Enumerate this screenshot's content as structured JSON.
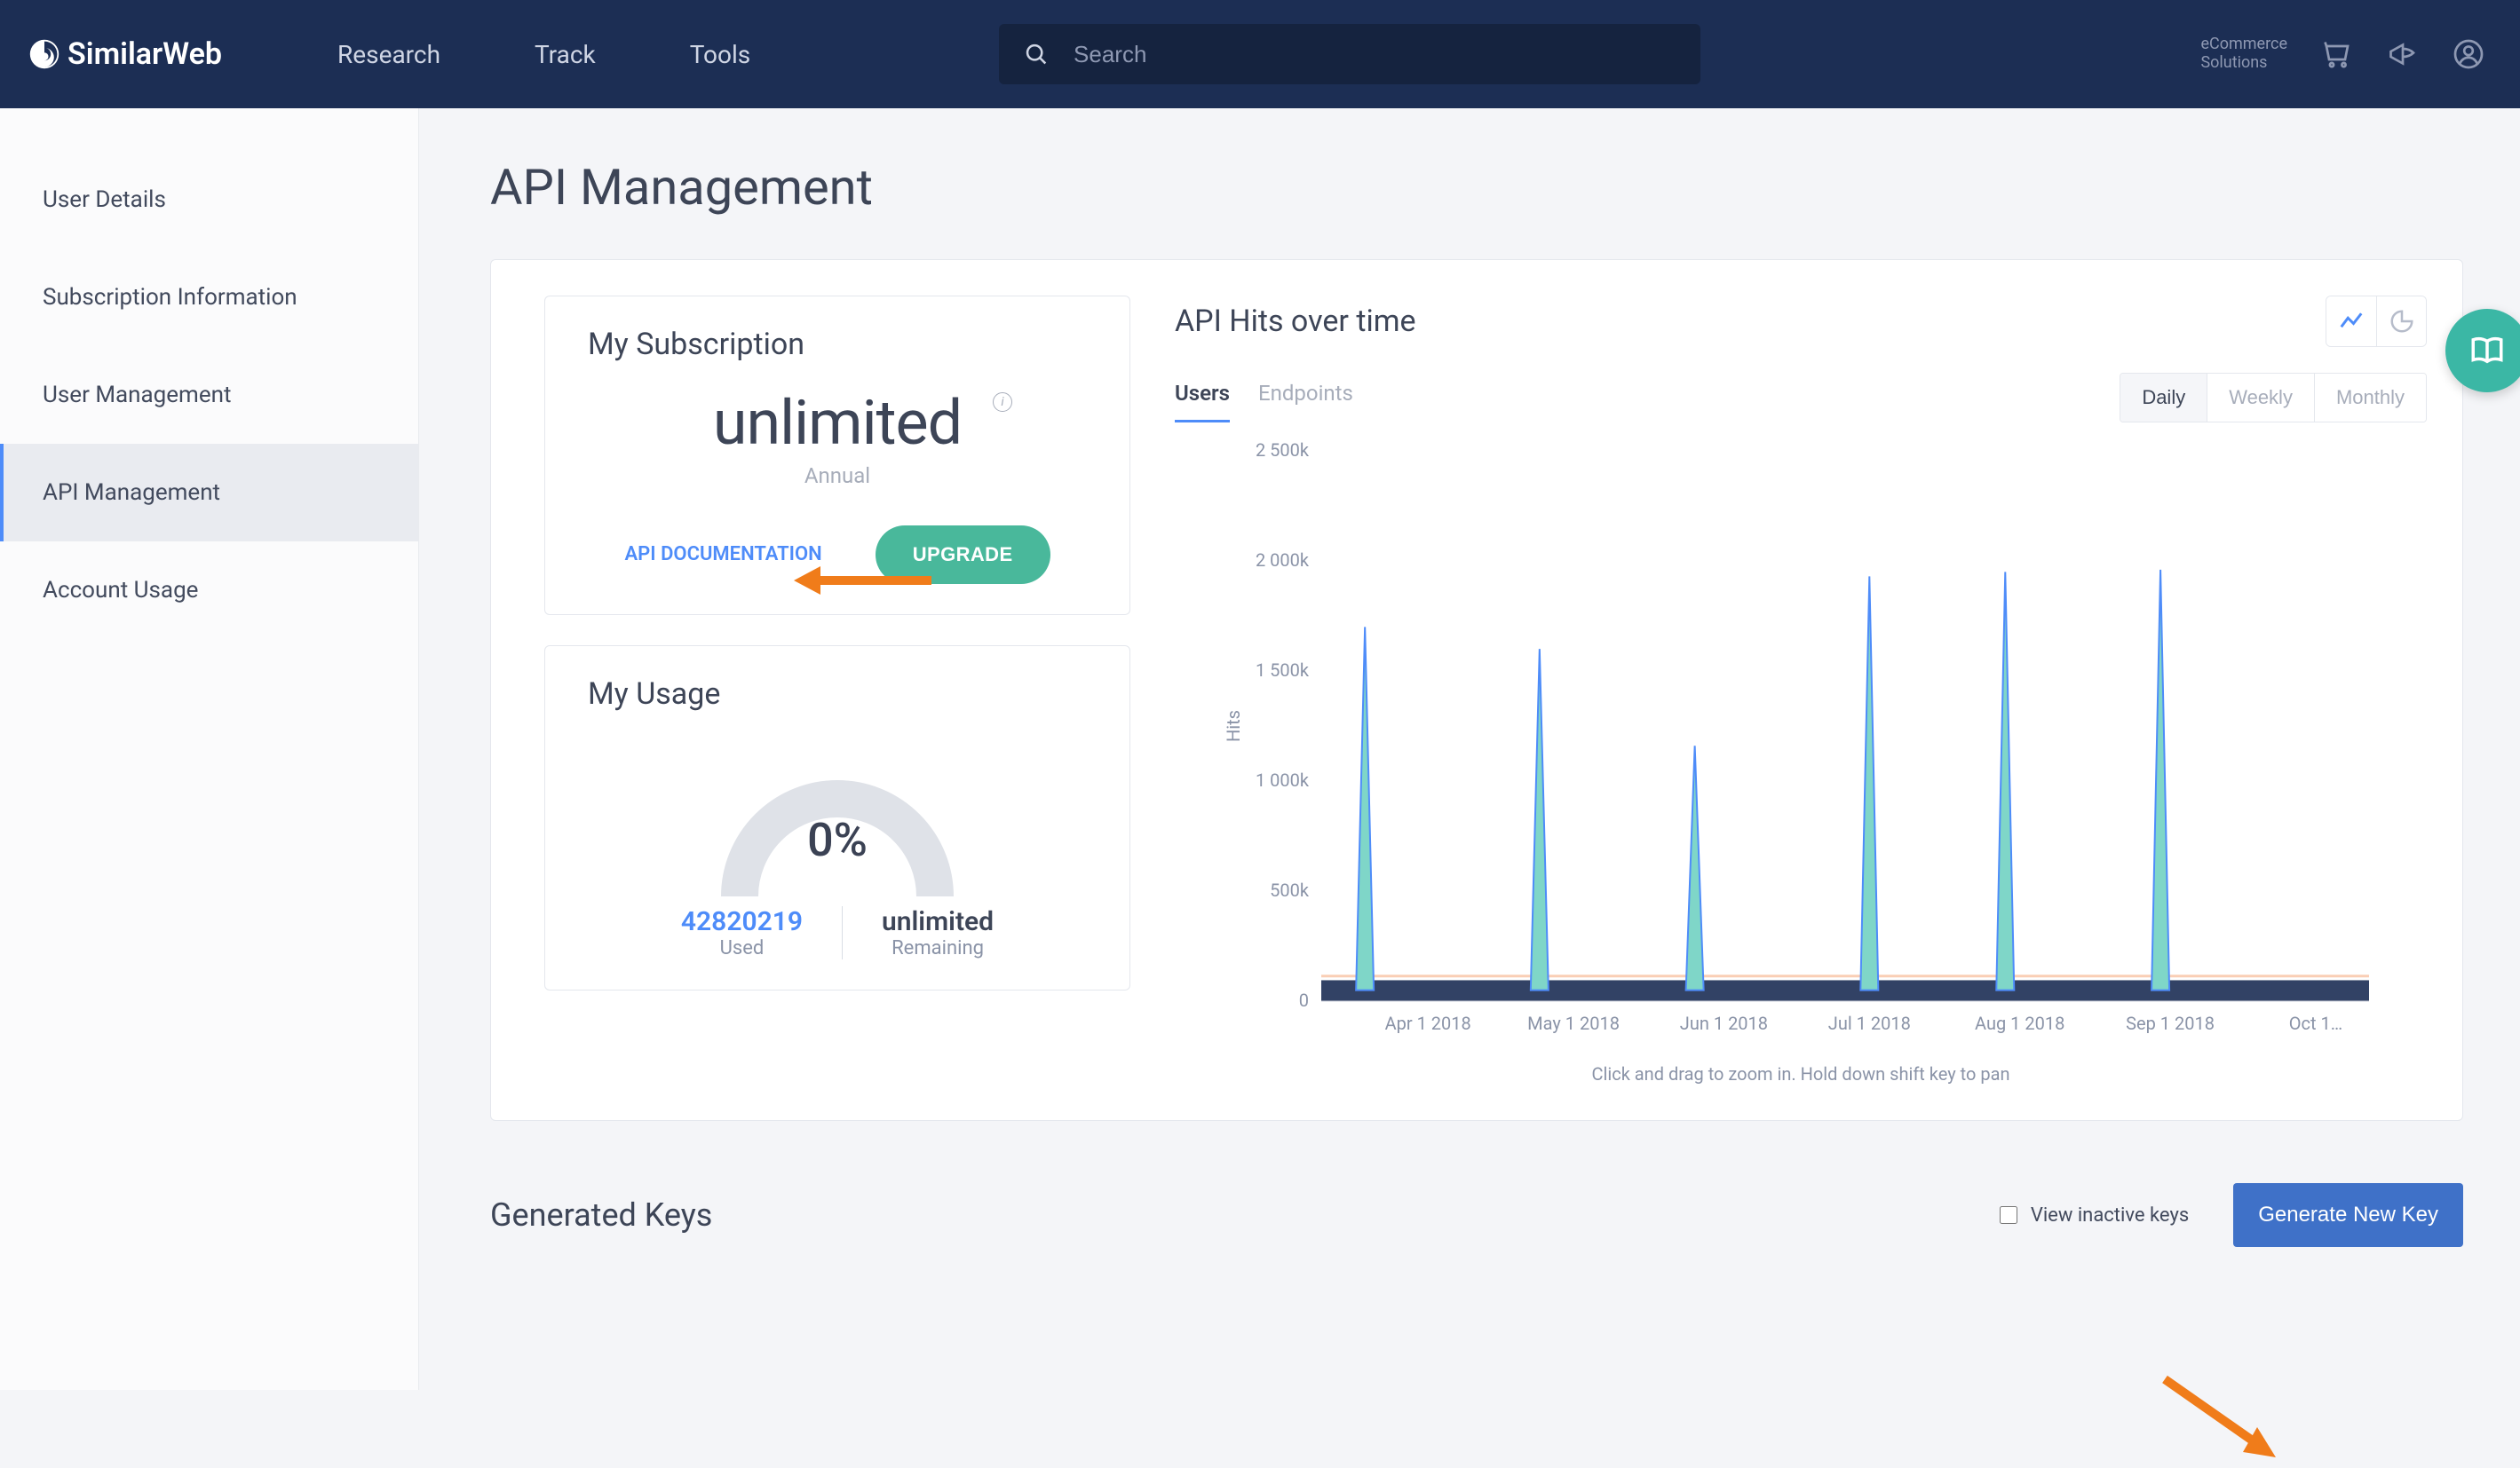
{
  "brand": "SimilarWeb",
  "topnav": {
    "research": "Research",
    "track": "Track",
    "tools": "Tools"
  },
  "search": {
    "placeholder": "Search"
  },
  "header_right": {
    "ecom_line1": "eCommerce",
    "ecom_line2": "Solutions"
  },
  "sidebar": {
    "items": [
      {
        "id": "user-details",
        "label": "User Details"
      },
      {
        "id": "subscription-info",
        "label": "Subscription Information"
      },
      {
        "id": "user-management",
        "label": "User Management"
      },
      {
        "id": "api-management",
        "label": "API Management",
        "selected": true
      },
      {
        "id": "account-usage",
        "label": "Account Usage"
      }
    ]
  },
  "page": {
    "title": "API Management"
  },
  "subscription": {
    "title": "My Subscription",
    "value": "unlimited",
    "period": "Annual",
    "doc_link": "API DOCUMENTATION",
    "upgrade": "UPGRADE"
  },
  "usage": {
    "title": "My Usage",
    "percent": "0%",
    "used_value": "42820219",
    "used_label": "Used",
    "remaining_value": "unlimited",
    "remaining_label": "Remaining"
  },
  "hits": {
    "title": "API Hits over time",
    "tabs": {
      "users": "Users",
      "endpoints": "Endpoints"
    },
    "ranges": {
      "daily": "Daily",
      "weekly": "Weekly",
      "monthly": "Monthly"
    },
    "y_label": "Hits",
    "hint": "Click and drag to zoom in. Hold down shift key to pan"
  },
  "generated_keys": {
    "title": "Generated Keys",
    "view_inactive": "View inactive keys",
    "generate": "Generate New Key"
  },
  "chart_data": {
    "type": "line",
    "title": "API Hits over time",
    "xlabel": "",
    "ylabel": "Hits",
    "ylim": [
      0,
      2500000
    ],
    "y_ticks": [
      0,
      500000,
      1000000,
      1500000,
      2000000,
      2500000
    ],
    "y_tick_labels": [
      "0",
      "500k",
      "1 000k",
      "1 500k",
      "2 000k",
      "2 500k"
    ],
    "x_tick_labels": [
      "Apr 1 2018",
      "May 1 2018",
      "Jun 1 2018",
      "Jul 1 2018",
      "Aug 1 2018",
      "Sep 1 2018",
      "Oct 1…"
    ],
    "series": [
      {
        "name": "Hits",
        "color": "#4e8cf9",
        "x": [
          "2018-03-18",
          "2018-03-19",
          "2018-04-01",
          "2018-04-23",
          "2018-04-24",
          "2018-05-15",
          "2018-05-25",
          "2018-05-26",
          "2018-06-15",
          "2018-06-30",
          "2018-07-01",
          "2018-07-20",
          "2018-07-28",
          "2018-07-29",
          "2018-08-15",
          "2018-08-29",
          "2018-08-30",
          "2018-09-10",
          "2018-10-05"
        ],
        "values": [
          60000,
          1700000,
          50000,
          50000,
          1600000,
          40000,
          40000,
          1160000,
          40000,
          40000,
          1930000,
          40000,
          40000,
          1950000,
          40000,
          40000,
          1960000,
          60000,
          60000
        ]
      },
      {
        "name": "Baseline",
        "color": "#1c2e54",
        "x": [
          "2018-03-15",
          "2018-10-10"
        ],
        "values": [
          50000,
          50000
        ]
      }
    ]
  }
}
